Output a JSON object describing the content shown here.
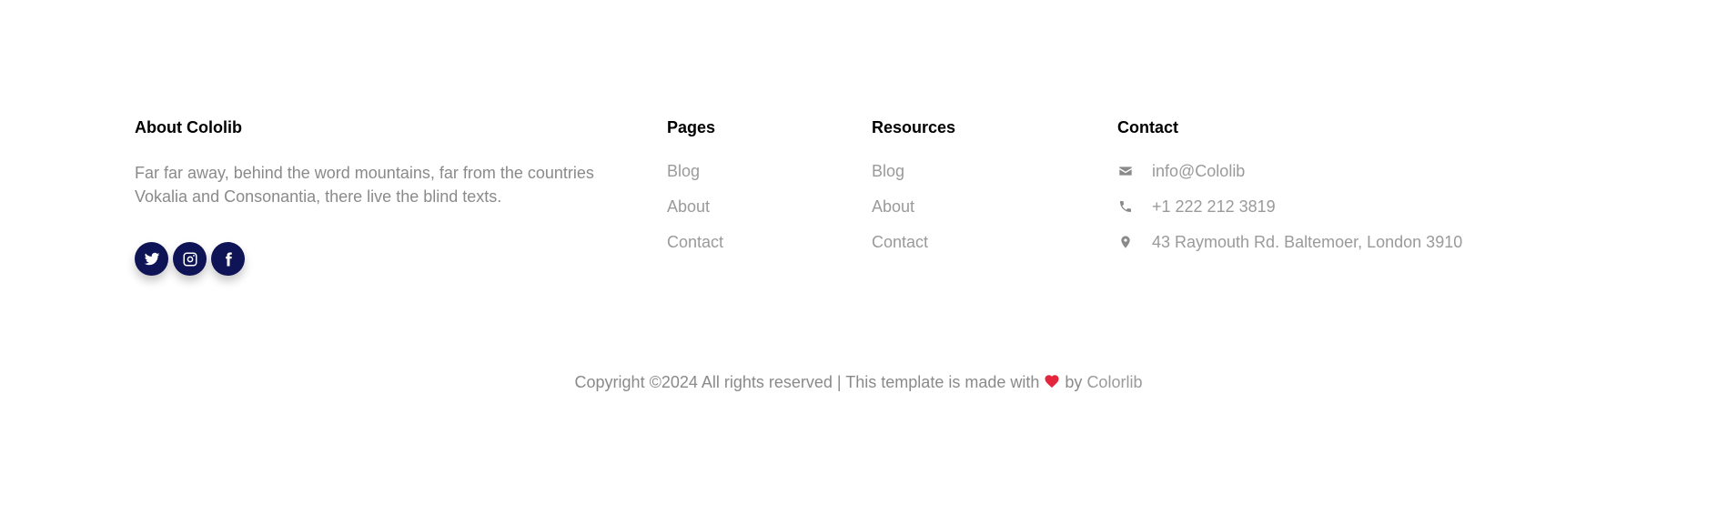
{
  "about": {
    "heading": "About Cololib",
    "text": "Far far away, behind the word mountains, far from the countries Vokalia and Consonantia, there live the blind texts.",
    "social": [
      {
        "icon": "twitter-icon"
      },
      {
        "icon": "instagram-icon"
      },
      {
        "icon": "facebook-icon"
      }
    ]
  },
  "pages": {
    "heading": "Pages",
    "links": [
      "Blog",
      "About",
      "Contact"
    ]
  },
  "resources": {
    "heading": "Resources",
    "links": [
      "Blog",
      "About",
      "Contact"
    ]
  },
  "contact": {
    "heading": "Contact",
    "email": "info@Cololib",
    "phone": "+1 222 212 3819",
    "address": "43 Raymouth Rd. Baltemoer, London 3910"
  },
  "footer": {
    "copyright_text": "Copyright ©2024 All rights reserved | This template is made with",
    "by_text": "by",
    "brand": "Colorlib"
  },
  "colors": {
    "social_bg": "#0f1457",
    "heart": "#e3263c",
    "muted_text": "#8a8a8a"
  }
}
